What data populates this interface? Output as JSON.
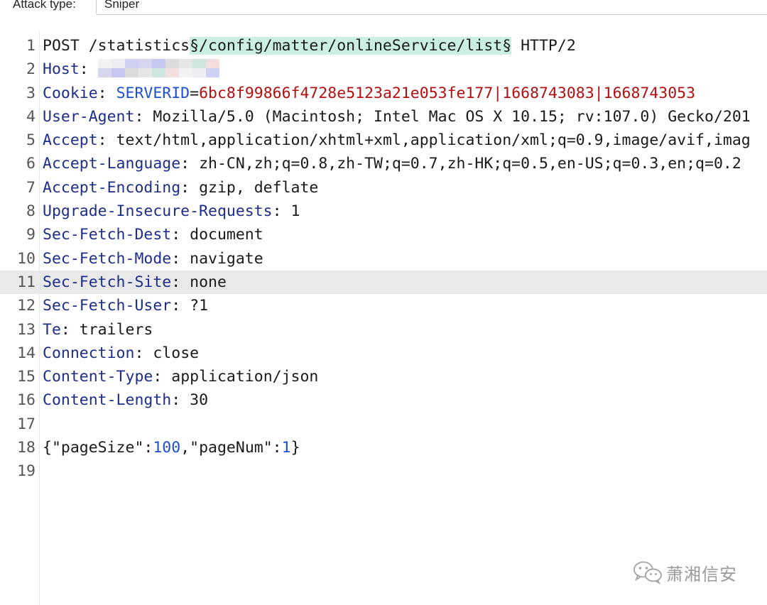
{
  "attack": {
    "label": "Attack type:",
    "value": "Sniper"
  },
  "lines": [
    {
      "n": "1"
    },
    {
      "n": "2",
      "key": "Host",
      "sep": ":"
    },
    {
      "n": "3",
      "key": "Cookie",
      "sep": ":"
    },
    {
      "n": "4",
      "key": "User-Agent",
      "sep": ":",
      "value": "Mozilla/5.0 (Macintosh; Intel Mac OS X 10.15; rv:107.0) Gecko/201"
    },
    {
      "n": "5",
      "key": "Accept",
      "sep": ":",
      "value": "text/html,application/xhtml+xml,application/xml;q=0.9,image/avif,imag"
    },
    {
      "n": "6",
      "key": "Accept-Language",
      "sep": ":",
      "value": "zh-CN,zh;q=0.8,zh-TW;q=0.7,zh-HK;q=0.5,en-US;q=0.3,en;q=0.2"
    },
    {
      "n": "7",
      "key": "Accept-Encoding",
      "sep": ":",
      "value": "gzip, deflate"
    },
    {
      "n": "8",
      "key": "Upgrade-Insecure-Requests",
      "sep": ":",
      "value": "1"
    },
    {
      "n": "9",
      "key": "Sec-Fetch-Dest",
      "sep": ":",
      "value": "document"
    },
    {
      "n": "10",
      "key": "Sec-Fetch-Mode",
      "sep": ":",
      "value": "navigate"
    },
    {
      "n": "11",
      "key": "Sec-Fetch-Site",
      "sep": ":",
      "value": "none"
    },
    {
      "n": "12",
      "key": "Sec-Fetch-User",
      "sep": ":",
      "value": "?1"
    },
    {
      "n": "13",
      "key": "Te",
      "sep": ":",
      "value": "trailers"
    },
    {
      "n": "14",
      "key": "Connection",
      "sep": ":",
      "value": "close"
    },
    {
      "n": "15",
      "key": "Content-Type",
      "sep": ":",
      "value": "application/json"
    },
    {
      "n": "16",
      "key": "Content-Length",
      "sep": ":",
      "value": "30"
    },
    {
      "n": "17"
    },
    {
      "n": "18"
    },
    {
      "n": "19"
    }
  ],
  "request_line": {
    "method_path": "POST /statistics",
    "payload": "§/config/matter/onlineService/list§",
    "protocol": " HTTP/2"
  },
  "cookie": {
    "name": "SERVERID",
    "eq": "=",
    "value": "6bc8f99866f4728e5123a21e053fe177|1668743083|1668743053"
  },
  "body_json": {
    "open": "{",
    "k1": "\"pageSize\"",
    "c1": ":",
    "v1": "100",
    "comma": ",",
    "k2": "\"pageNum\"",
    "c2": ":",
    "v2": "1",
    "close": "}"
  },
  "host_mask_colors": [
    "#f2f2f4",
    "#eeeef2",
    "#ced0f4",
    "#d6d6ee",
    "#c6c8f2",
    "#dcdcdc",
    "#e6e6e6",
    "#cfe6e0",
    "#f2dede"
  ],
  "colors": {
    "key": "#1c2d8a",
    "cookie_value": "#b30f0f",
    "number": "#1b4fd6",
    "payload_bg": "#c9f0e2",
    "highlight": "#e9e9e9"
  },
  "watermark": {
    "text": "萧湘信安",
    "icon": "wechat-icon"
  }
}
